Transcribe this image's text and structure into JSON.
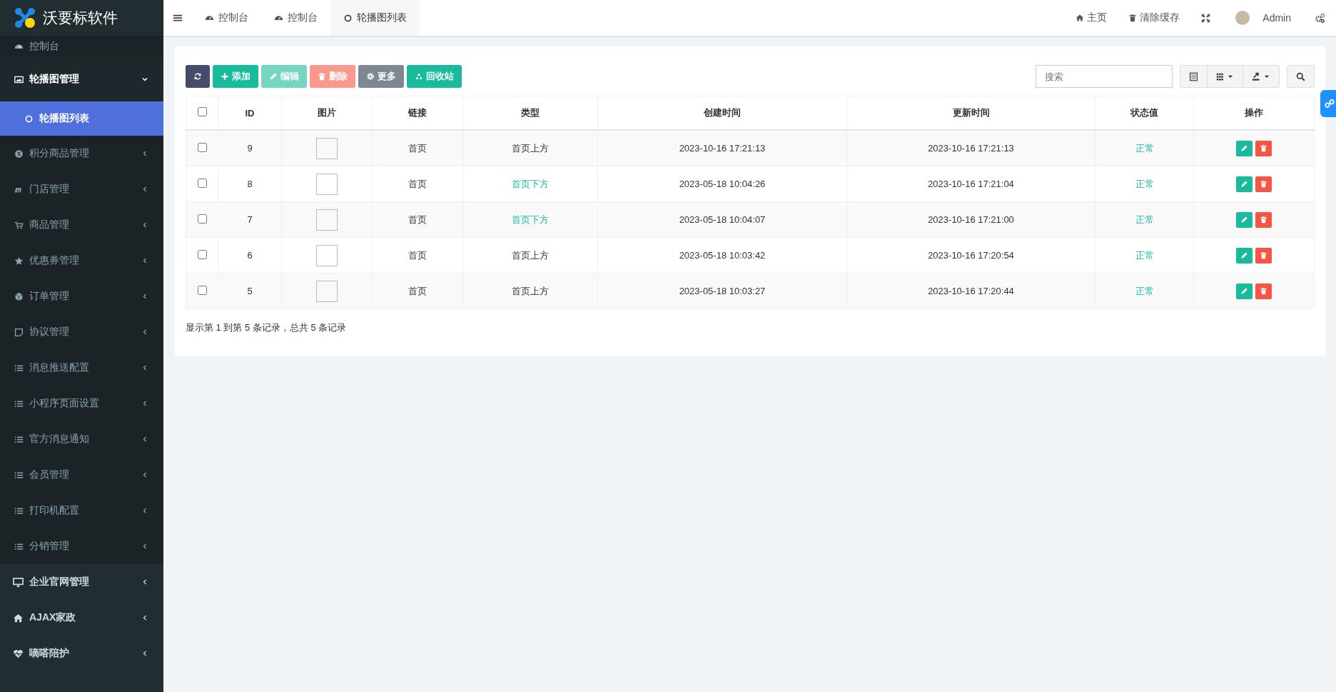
{
  "brand": {
    "name": "沃要标软件"
  },
  "sidebar": {
    "items": [
      {
        "kind": "link",
        "label": "控制台"
      },
      {
        "kind": "group",
        "label": "轮播图管理",
        "expanded": true
      },
      {
        "kind": "sub",
        "label": "轮播图列表",
        "selected": true
      },
      {
        "kind": "item",
        "label": "积分商品管理",
        "expanded": false
      },
      {
        "kind": "item",
        "label": "门店管理",
        "expanded": false
      },
      {
        "kind": "item",
        "label": "商品管理",
        "expanded": false
      },
      {
        "kind": "item",
        "label": "优惠券管理",
        "expanded": false
      },
      {
        "kind": "item",
        "label": "订单管理",
        "expanded": false
      },
      {
        "kind": "item",
        "label": "协议管理",
        "expanded": false
      },
      {
        "kind": "item",
        "label": "消息推送配置",
        "expanded": false
      },
      {
        "kind": "item",
        "label": "小程序页面设置",
        "expanded": false
      },
      {
        "kind": "item",
        "label": "官方消息通知",
        "expanded": false
      },
      {
        "kind": "item",
        "label": "会员管理",
        "expanded": false
      },
      {
        "kind": "item",
        "label": "打印机配置",
        "expanded": false
      },
      {
        "kind": "item",
        "label": "分销管理",
        "expanded": false
      },
      {
        "kind": "section",
        "label": "企业官网管理",
        "expanded": false
      },
      {
        "kind": "section",
        "label": "AJAX家政",
        "expanded": false
      },
      {
        "kind": "section",
        "label": "嘀嗒陪护",
        "expanded": false
      }
    ]
  },
  "header": {
    "tabs": [
      {
        "label": "控制台",
        "selected": false
      },
      {
        "label": "控制台",
        "selected": false
      },
      {
        "label": "轮播图列表",
        "selected": true
      }
    ],
    "links": [
      {
        "label": "主页"
      },
      {
        "label": "清除缓存"
      }
    ],
    "user": "Admin"
  },
  "toolbar": {
    "buttons": [
      {
        "kind": "refresh",
        "disabled": false
      },
      {
        "kind": "add",
        "label": "添加",
        "disabled": false
      },
      {
        "kind": "edit",
        "label": "编辑",
        "disabled": true
      },
      {
        "kind": "delete",
        "label": "删除",
        "disabled": true
      },
      {
        "kind": "more",
        "label": "更多",
        "disabled": false
      },
      {
        "kind": "recycle",
        "label": "回收站",
        "disabled": false
      }
    ],
    "search": {
      "placeholder": "搜索"
    }
  },
  "table": {
    "header_checked": false,
    "columns": [
      "ID",
      "图片",
      "链接",
      "类型",
      "创建时间",
      "更新时间",
      "状态值",
      "操作"
    ],
    "rows": [
      {
        "checked": false,
        "id": "9",
        "link": "首页",
        "type": {
          "label": "首页上方",
          "color": "#333333"
        },
        "created": "2023-10-16 17:21:13",
        "updated": "2023-10-16 17:21:13",
        "status": "正常"
      },
      {
        "checked": false,
        "id": "8",
        "link": "首页",
        "type": {
          "label": "首页下方",
          "color": "#18bc9c"
        },
        "created": "2023-05-18 10:04:26",
        "updated": "2023-10-16 17:21:04",
        "status": "正常"
      },
      {
        "checked": false,
        "id": "7",
        "link": "首页",
        "type": {
          "label": "首页下方",
          "color": "#18bc9c"
        },
        "created": "2023-05-18 10:04:07",
        "updated": "2023-10-16 17:21:00",
        "status": "正常"
      },
      {
        "checked": false,
        "id": "6",
        "link": "首页",
        "type": {
          "label": "首页上方",
          "color": "#333333"
        },
        "created": "2023-05-18 10:03:42",
        "updated": "2023-10-16 17:20:54",
        "status": "正常"
      },
      {
        "checked": false,
        "id": "5",
        "link": "首页",
        "type": {
          "label": "首页上方",
          "color": "#333333"
        },
        "created": "2023-05-18 10:03:27",
        "updated": "2023-10-16 17:20:44",
        "status": "正常"
      }
    ]
  },
  "pagination": {
    "summary": "显示第 1 到第 5 条记录，总共 5 条记录"
  }
}
